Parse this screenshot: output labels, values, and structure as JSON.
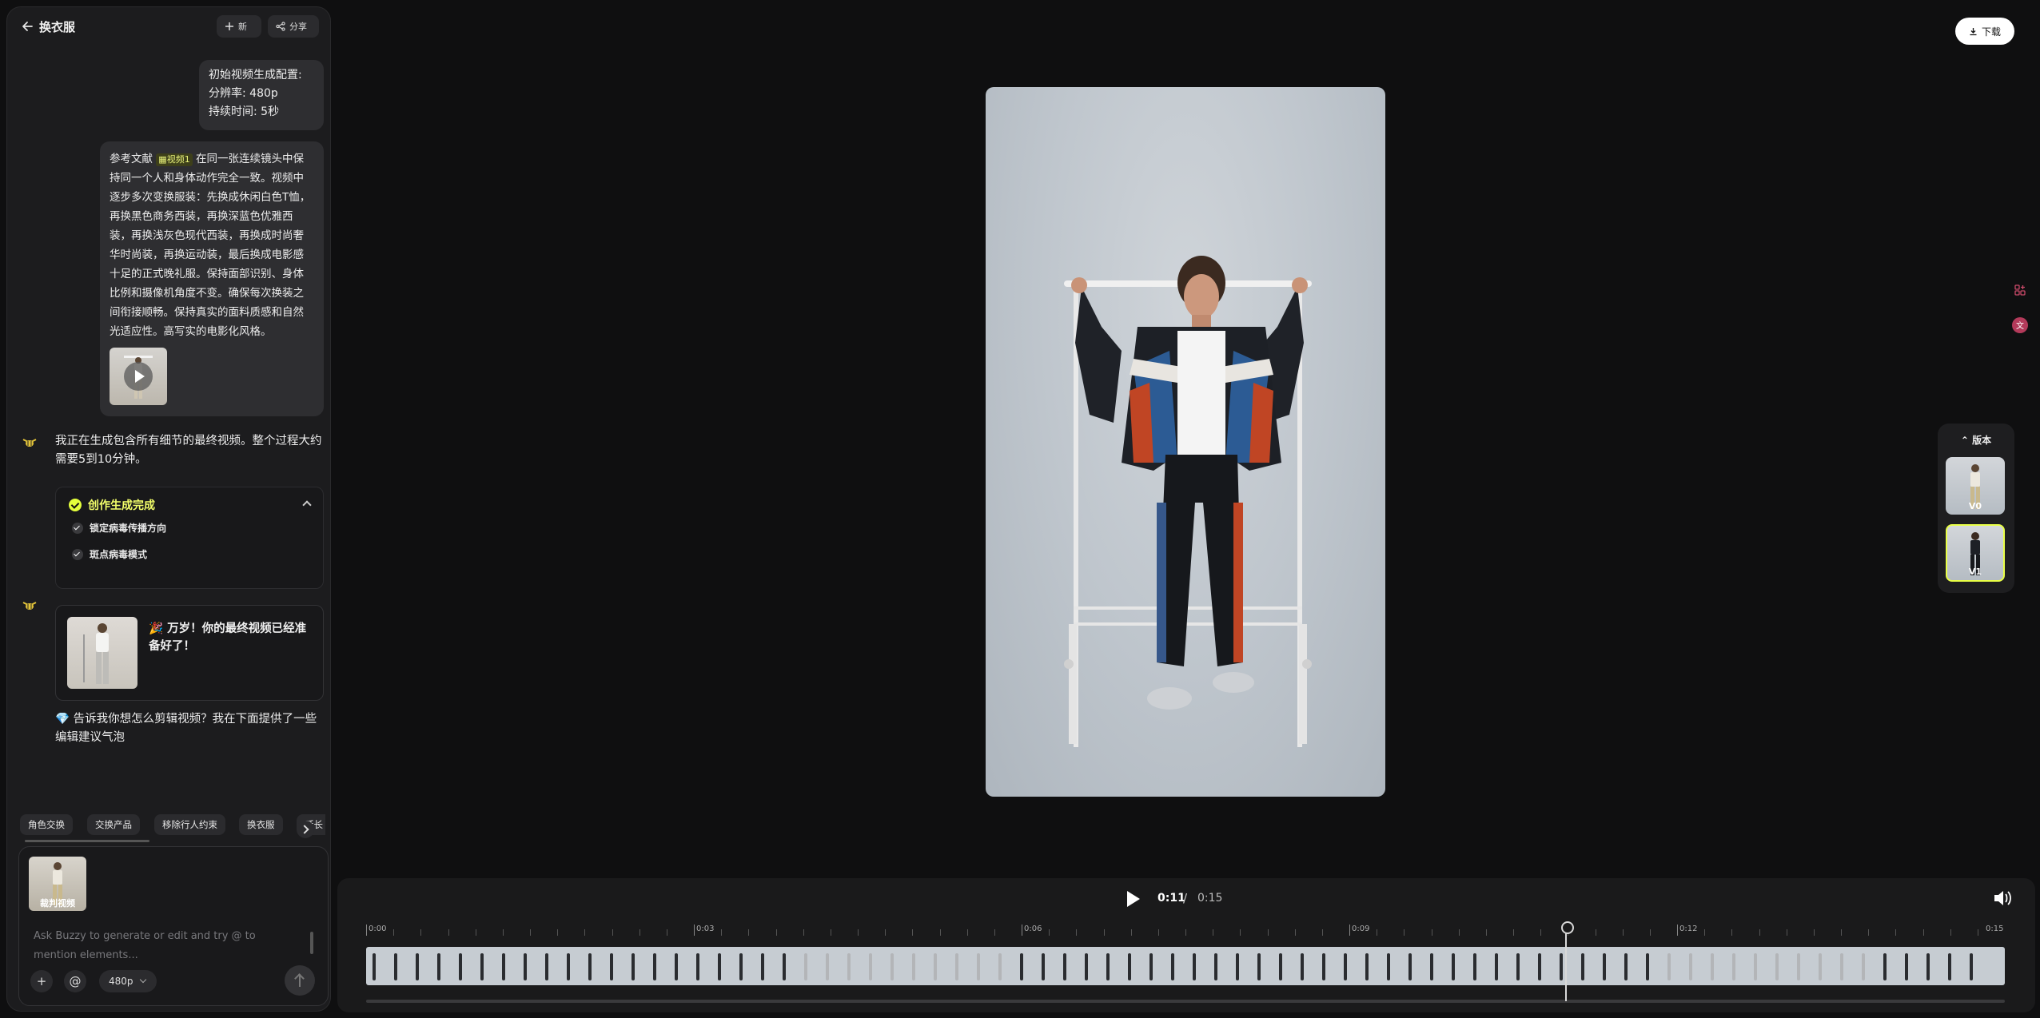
{
  "sidebar": {
    "title": "换衣服",
    "new_label": "新",
    "share_label": "分享",
    "user_msg_config": [
      "初始视频生成配置:",
      "分辨率: 480p",
      "持续时间: 5秒"
    ],
    "user_msg_prompt": {
      "ref_prefix": "参考文献",
      "ref_tag": "视频1",
      "text": "在同一张连续镜头中保持同一个人和身体动作完全一致。视频中逐步多次变换服装：先换成休闲白色T恤，再换黑色商务西装，再换深蓝色优雅西装，再换浅灰色现代西装，再换成时尚奢华时尚装，再换运动装，最后换成电影感十足的正式晚礼服。保持面部识别、身体比例和摄像机角度不变。确保每次换装之间衔接顺畅。保持真实的面料质感和自然光适应性。高写实的电影化风格。"
    },
    "bot_msg_1": "我正在生成包含所有细节的最终视频。整个过程大约需要5到10分钟。",
    "steps": {
      "title": "创作生成完成",
      "items": [
        "锁定病毒传播方向",
        "斑点病毒模式"
      ]
    },
    "final_msg": "🎉 万岁！你的最终视频已经准备好了！",
    "bot_msg_2": "💎 告诉我你想怎么剪辑视频？我在下面提供了一些编辑建议气泡",
    "chips": [
      "角色交换",
      "交换产品",
      "移除行人约束",
      "换衣服",
      "延长"
    ],
    "attachment_label": "裁判视频",
    "input_placeholder": "Ask Buzzy to generate or edit and try @ to mention elements...",
    "plus_label": "+",
    "at_label": "@",
    "resolution": "480p"
  },
  "main": {
    "download_label": "下载",
    "versions_title": "版本",
    "versions": [
      "V0",
      "V1"
    ]
  },
  "player": {
    "current_time": "0:11",
    "separator": "/",
    "total_time": "0:15",
    "ruler_labels": [
      "0:00",
      "0:03",
      "0:06",
      "0:09",
      "0:12",
      "0:15"
    ]
  },
  "colors": {
    "accent": "#e9ff46",
    "background": "#0f0f10",
    "panel": "#1c1c1e"
  }
}
